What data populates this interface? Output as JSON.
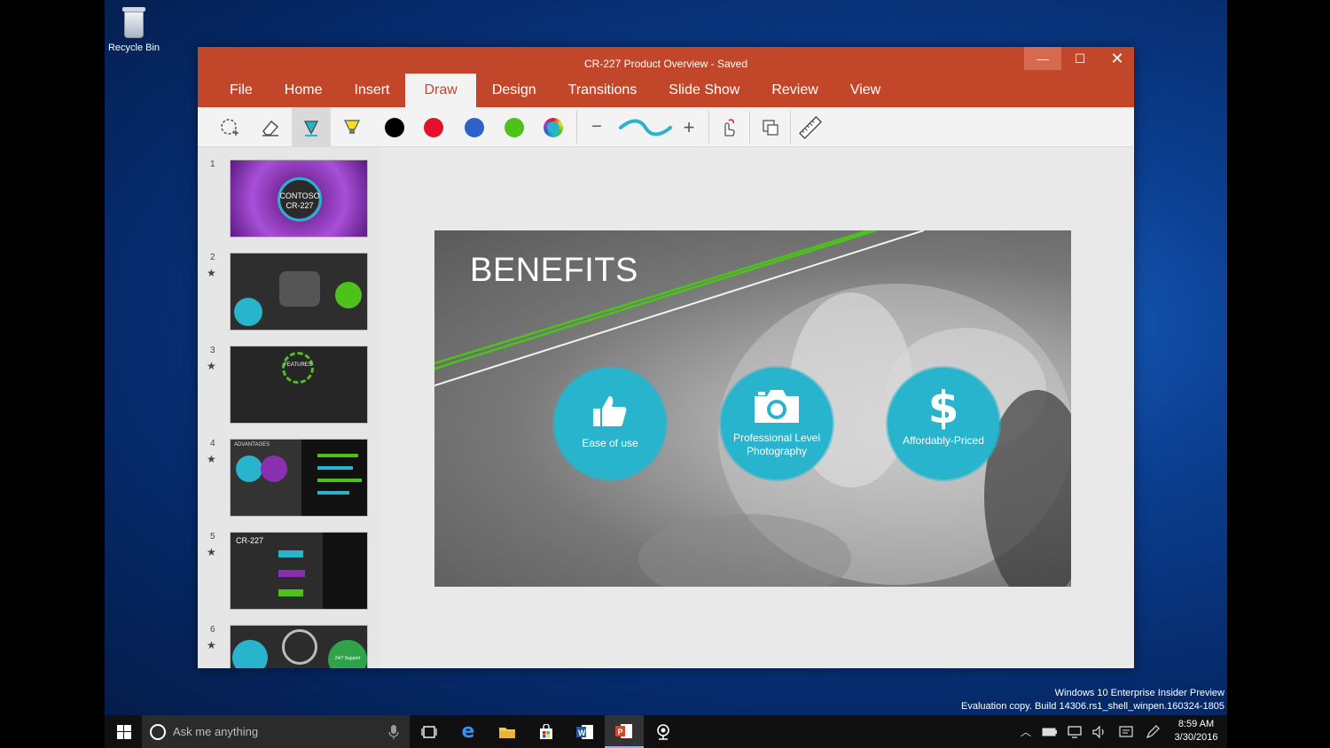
{
  "desktop": {
    "recycle_bin_label": "Recycle Bin",
    "watermark_line1": "Windows 10 Enterprise Insider Preview",
    "watermark_line2": "Evaluation copy. Build 14306.rs1_shell_winpen.160324-1805"
  },
  "window": {
    "title": "CR-227 Product Overview - Saved",
    "tabs": [
      "File",
      "Home",
      "Insert",
      "Draw",
      "Design",
      "Transitions",
      "Slide Show",
      "Review",
      "View"
    ],
    "active_tab": "Draw"
  },
  "toolbar": {
    "tools": [
      "lasso-select",
      "eraser",
      "pen",
      "highlighter"
    ],
    "colors": [
      "#000000",
      "#e3122a",
      "#2d63c8",
      "#4cc21b",
      "color-picker"
    ],
    "stroke_minus": "−",
    "stroke_plus": "+",
    "extra_tools": [
      "touch-draw",
      "ink-to-shape",
      "ruler"
    ]
  },
  "thumbnails": [
    {
      "num": "1",
      "star": "",
      "text": "CONTOSO CR-227"
    },
    {
      "num": "2",
      "star": "★",
      "text": ""
    },
    {
      "num": "3",
      "star": "★",
      "text": "FEATURES"
    },
    {
      "num": "4",
      "star": "★",
      "text": "ADVANTAGES"
    },
    {
      "num": "5",
      "star": "★",
      "text": "CR-227"
    },
    {
      "num": "6",
      "star": "★",
      "text": "24/7 Support"
    }
  ],
  "slide": {
    "title": "BENEFITS",
    "benefits": [
      {
        "label": "Ease of use",
        "icon": "thumbs-up-icon"
      },
      {
        "label": "Professional Level Photography",
        "icon": "camera-icon"
      },
      {
        "label": "Affordably-Priced",
        "icon": "dollar-icon"
      }
    ],
    "accent_color": "#27b4cc",
    "ink_color": "#4cc21b"
  },
  "taskbar": {
    "search_placeholder": "Ask me anything",
    "time": "8:59 AM",
    "date": "3/30/2016"
  }
}
